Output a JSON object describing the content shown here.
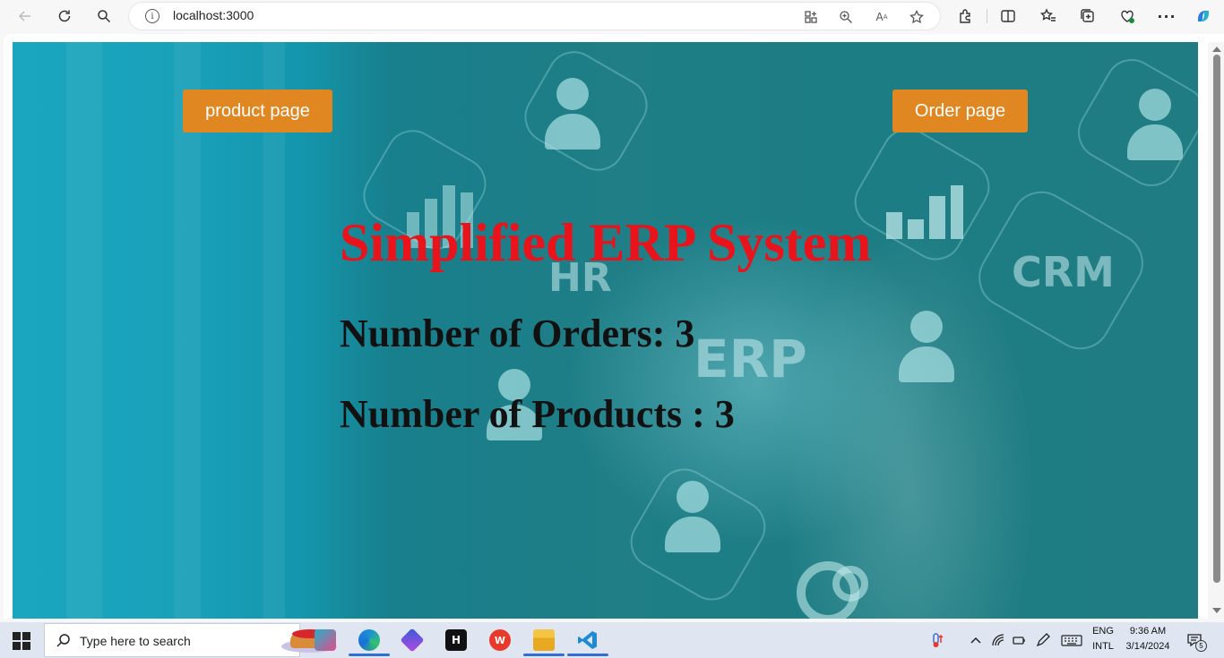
{
  "browser": {
    "url": "localhost:3000"
  },
  "page": {
    "product_button": "product page",
    "order_button": "Order page",
    "title": "Simplified ERP System",
    "orders_label": "Number of Orders: 3",
    "products_label": "Number of Products : 3",
    "background_labels": {
      "hr": "HR",
      "erp": "ERP",
      "crm": "CRM"
    },
    "colors": {
      "title": "#e8131b",
      "button": "#e08722",
      "background": "#1d7d84"
    }
  },
  "taskbar": {
    "search_placeholder": "Type here to search",
    "language_top": "ENG",
    "language_bottom": "INTL",
    "time": "9:36 AM",
    "date": "3/14/2024",
    "notification_count": "5"
  }
}
